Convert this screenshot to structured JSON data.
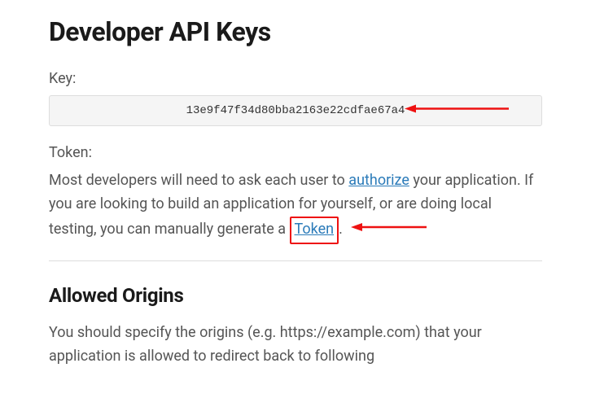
{
  "headings": {
    "main": "Developer API Keys",
    "origins": "Allowed Origins"
  },
  "labels": {
    "key": "Key:",
    "token": "Token:"
  },
  "key_value": "13e9f47f34d80bba2163e22cdfae67a4",
  "token_description": {
    "part1": "Most developers will need to ask each user to ",
    "authorize_link": "authorize",
    "part2": " your application. If you are looking to build an application for yourself, or are doing local testing, you can manually generate a ",
    "token_link": "Token",
    "part3": "."
  },
  "origins_description": "You should specify the origins (e.g. https://example.com) that your application is allowed to redirect back to following",
  "colors": {
    "arrow": "#e11"
  }
}
